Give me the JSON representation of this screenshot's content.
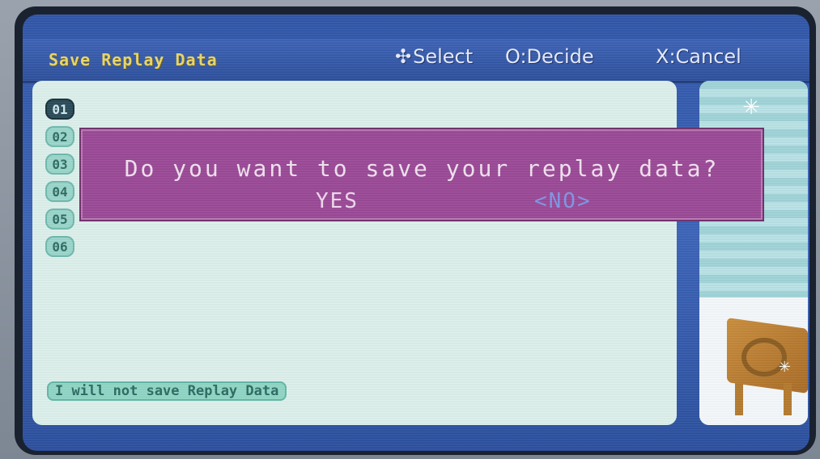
{
  "header": {
    "title": "Save Replay Data",
    "select_hint": "Select",
    "decide_hint": "O:Decide",
    "cancel_hint": "X:Cancel"
  },
  "slots": [
    "01",
    "02",
    "03",
    "04",
    "05",
    "06"
  ],
  "no_save_option": "I will not save Replay Data",
  "dialog": {
    "question": "Do you want to save your replay data?",
    "yes_label": "YES",
    "no_label": "<NO>"
  },
  "icons": {
    "dpad": "dpad-icon",
    "sparkle": "sparkle-icon"
  },
  "colors": {
    "dialog_bg": "#9a4896",
    "panel_bg": "#ddf0ec",
    "header_title": "#e8d76a"
  }
}
